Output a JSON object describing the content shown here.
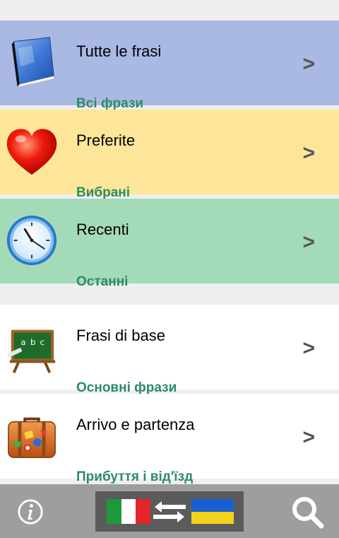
{
  "menu": {
    "items": [
      {
        "title": "Tutte le frasi",
        "subtitle": "Всі фрази",
        "icon": "book-icon",
        "bg": "#aab8e4",
        "chevron": ">"
      },
      {
        "title": "Preferite",
        "subtitle": "Вибрані",
        "icon": "heart-icon",
        "bg": "#fde59a",
        "chevron": ">"
      },
      {
        "title": "Recenti",
        "subtitle": "Останні",
        "icon": "clock-icon",
        "bg": "#a3dbb8",
        "chevron": ">"
      },
      {
        "title": "Frasi di base",
        "subtitle": "Основні фрази",
        "icon": "blackboard-icon",
        "bg": "#ffffff",
        "chevron": ">"
      },
      {
        "title": "Arrivo e partenza",
        "subtitle": "Прибуття і від'їзд",
        "icon": "suitcase-icon",
        "bg": "#ffffff",
        "chevron": ">"
      }
    ]
  },
  "bottom_bar": {
    "info_icon": "info-icon",
    "language_switch": {
      "from_flag": "italy-flag-icon",
      "to_flag": "ukraine-flag-icon",
      "swap_icon": "swap-arrows-icon"
    },
    "search_icon": "search-icon"
  },
  "colors": {
    "subtitle": "#2e8b64",
    "chevron": "#555555",
    "bottom_bar": "#9e9e9e"
  }
}
